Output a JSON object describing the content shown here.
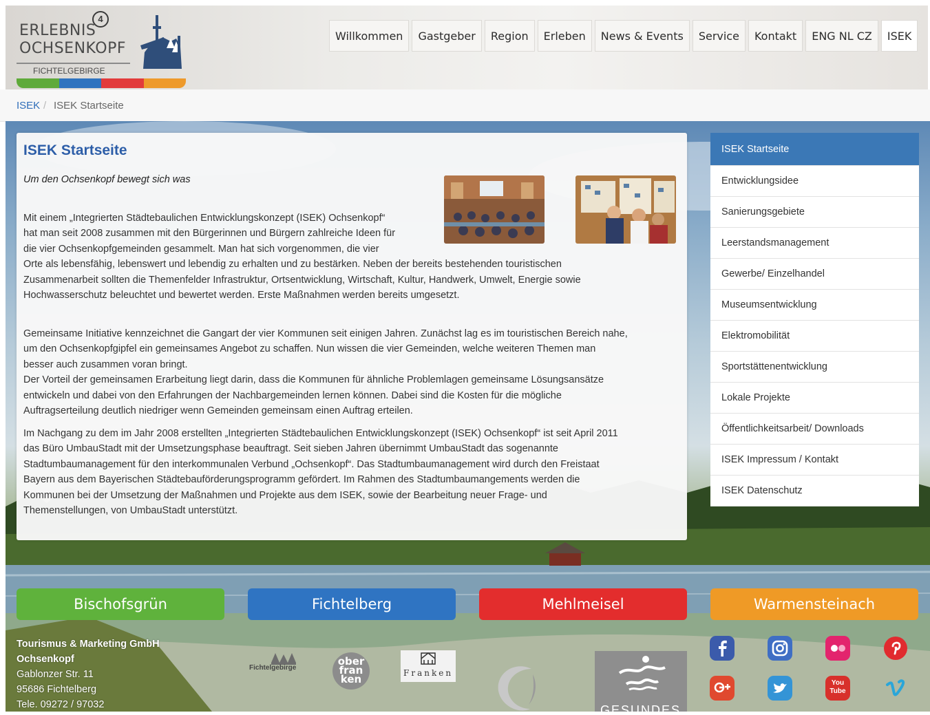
{
  "header": {
    "logo": {
      "line1": "ERLEBNIS",
      "badge": "4",
      "line2": "OCHSENKOPF",
      "sub": "FICHTELGEBIRGE",
      "stripe_colors": [
        "#5faa3a",
        "#2f73bf",
        "#e23b3b",
        "#ee9a2b"
      ]
    },
    "nav": [
      {
        "label": "Willkommen"
      },
      {
        "label": "Gastgeber"
      },
      {
        "label": "Region"
      },
      {
        "label": "Erleben"
      },
      {
        "label": "News & Events"
      },
      {
        "label": "Service"
      },
      {
        "label": "Kontakt"
      },
      {
        "label": "ENG NL CZ"
      },
      {
        "label": "ISEK"
      }
    ]
  },
  "breadcrumb": {
    "items": [
      {
        "label": "ISEK"
      },
      {
        "label": "/"
      },
      {
        "label": "ISEK Startseite"
      }
    ]
  },
  "main": {
    "title": "ISEK Startseite",
    "subtitle": "Um den Ochsenkopf bewegt sich was",
    "paragraph1_lines": [
      "Mit einem „Integrierten Städtebaulichen Entwicklungskonzept (ISEK) Ochsenkopf“",
      "hat man seit 2008 zusammen mit den Bürgerinnen und Bürgern zahlreiche Ideen für",
      "die vier Ochsenkopfgemeinden gesammelt. Man hat sich vorgenommen, die vier",
      "Orte als lebensfähig, lebenswert und lebendig zu erhalten und zu bestärken. Neben der bereits bestehenden touristischen",
      "Zusammenarbeit sollten die Themenfelder Infrastruktur, Ortsentwicklung, Wirtschaft, Kultur, Handwerk, Umwelt, Energie sowie",
      "Hochwasserschutz beleuchtet und bewertet werden. Erste Maßnahmen werden bereits umgesetzt."
    ],
    "paragraph2_lines": [
      "Gemeinsame Initiative kennzeichnet die Gangart der vier Kommunen seit einigen Jahren. Zunächst lag es im touristischen Bereich nahe,",
      "um den Ochsenkopfgipfel ein gemeinsames Angebot zu schaffen. Nun wissen die vier Gemeinden, welche weiteren Themen man",
      "besser auch zusammen voran bringt.",
      "Der Vorteil der gemeinsamen Erarbeitung liegt darin, dass die Kommunen für ähnliche Problemlagen gemeinsame Lösungsansätze",
      "entwickeln und dabei von den Erfahrungen der Nachbargemeinden lernen können. Dabei sind die Kosten für die mögliche",
      "Auftragserteilung deutlich niedriger wenn Gemeinden gemeinsam einen Auftrag erteilen."
    ],
    "paragraph3_lines": [
      "Im Nachgang zu dem im Jahr 2008 erstellten „Integrierten Städtebaulichen Entwicklungskonzept (ISEK) Ochsenkopf“ ist seit April 2011",
      "das Büro UmbauStadt mit der Umsetzungsphase beauftragt. Seit sieben Jahren übernimmt UmbauStadt das sogenannte",
      "Stadtumbaumanagement für den interkommunalen Verbund „Ochsenkopf“. Das Stadtumbaumanagement wird durch den Freistaat",
      "Bayern aus dem Bayerischen Städtebauförderungsprogramm gefördert. Im Rahmen des Stadtumbaumangements werden die",
      "Kommunen bei der Umsetzung der Maßnahmen und Projekte aus dem ISEK, sowie der Bearbeitung neuer Frage- und",
      "Themenstellungen, von UmbauStadt unterstützt."
    ]
  },
  "sidebar": {
    "items": [
      {
        "label": "ISEK Startseite"
      },
      {
        "label": "Entwicklungsidee"
      },
      {
        "label": "Sanierungsgebiete"
      },
      {
        "label": "Leerstandsmanagement"
      },
      {
        "label": "Gewerbe/ Einzelhandel"
      },
      {
        "label": "Museumsentwicklung"
      },
      {
        "label": "Elektromobilität"
      },
      {
        "label": "Sportstättenentwicklung"
      },
      {
        "label": "Lokale Projekte"
      },
      {
        "label": "Öffentlichkeitsarbeit/ Downloads"
      },
      {
        "label": "ISEK Impressum / Kontakt"
      },
      {
        "label": "ISEK Datenschutz"
      }
    ]
  },
  "communities": [
    {
      "label": "Bischofsgrün",
      "color": "#5fb23c"
    },
    {
      "label": "Fichtelberg",
      "color": "#2f74c2"
    },
    {
      "label": "Mehlmeisel",
      "color": "#e32d2d"
    },
    {
      "label": "Warmensteinach",
      "color": "#ef9a26"
    }
  ],
  "footer": {
    "address": {
      "company_line1": "Tourismus & Marketing GmbH",
      "company_line2": "Ochsenkopf",
      "street": "Gablonzer Str. 11",
      "city": "95686 Fichtelberg",
      "phone": "Tele. 09272 / 97032"
    },
    "partner_logos": [
      {
        "name": "naturpark-fichtelgebirge-logo",
        "text": "Fichtelgebirge"
      },
      {
        "name": "oberfranken-logo",
        "text": "ober fran ken"
      },
      {
        "name": "franken-logo",
        "text": "Franken"
      },
      {
        "name": "bavaria-logo"
      },
      {
        "name": "gesundes-bayern-logo",
        "text": "GESUNDES"
      }
    ],
    "social": [
      {
        "icon": "facebook-icon",
        "color": "#3b5bab"
      },
      {
        "icon": "instagram-icon",
        "color": "#3f6ec4"
      },
      {
        "icon": "flickr-icon",
        "color": "#e3246d"
      },
      {
        "icon": "pinterest-icon",
        "color": "#e12b2f"
      },
      {
        "icon": "googleplus-icon",
        "color": "#e0492f"
      },
      {
        "icon": "twitter-icon",
        "color": "#3494d6"
      },
      {
        "icon": "youtube-icon",
        "color": "#d8302b"
      },
      {
        "icon": "vimeo-icon",
        "color": "#2aa6d9"
      }
    ],
    "youtube_text": "You Tube"
  }
}
